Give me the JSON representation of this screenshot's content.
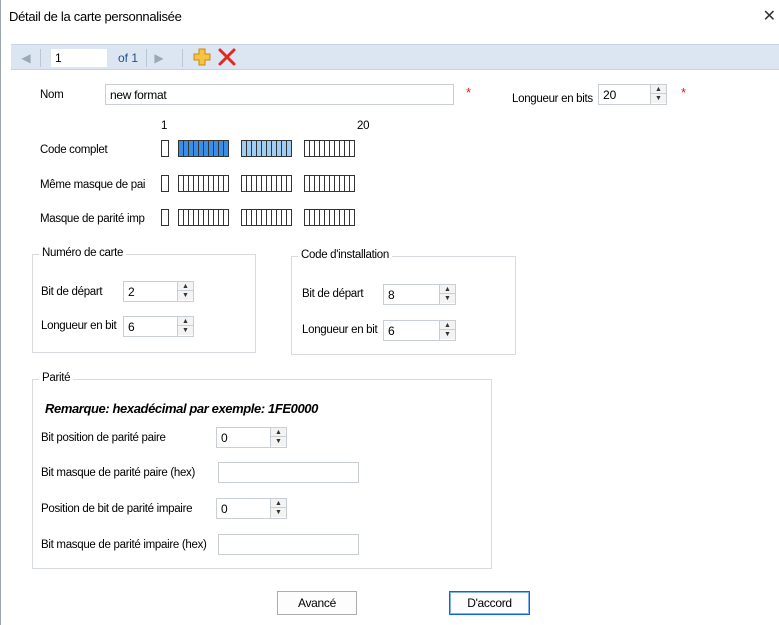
{
  "window": {
    "title": "Détail de la carte personnalisée",
    "close_glyph": "✕"
  },
  "navigator": {
    "current_page": "1",
    "of_label": "of 1",
    "first_icon": "prev-arrow-icon",
    "next_icon": "next-arrow-icon",
    "add_icon": "add-plus-icon",
    "delete_icon": "delete-x-icon"
  },
  "format": {
    "name_label": "Nom",
    "name_value": "new format",
    "length_label": "Longueur en bits",
    "length_value": "20",
    "required_mark": "*"
  },
  "bit_preview": {
    "start_index": "1",
    "end_index": "20",
    "rows": [
      {
        "label": "Code complet"
      },
      {
        "label": "Même masque de pai"
      },
      {
        "label": "Masque de parité imp"
      }
    ],
    "highlight_dark": "#3a8ee6",
    "highlight_light": "#9fcdf3"
  },
  "card_number": {
    "title": "Numéro de carte",
    "start_label": "Bit de départ",
    "start_value": "2",
    "length_label": "Longueur en bit",
    "length_value": "6"
  },
  "facility_code": {
    "title": "Code d'installation",
    "start_label": "Bit de départ",
    "start_value": "8",
    "length_label": "Longueur en bit",
    "length_value": "6"
  },
  "parity": {
    "title": "Parité",
    "note": "Remarque: hexadécimal par exemple: 1FE0000",
    "even_pos_label": "Bit position de parité paire",
    "even_pos_value": "0",
    "even_mask_label": "Bit masque de parité paire (hex)",
    "even_mask_value": "",
    "odd_pos_label": "Position de bit de parité impaire",
    "odd_pos_value": "0",
    "odd_mask_label": "Bit masque de parité impaire (hex)",
    "odd_mask_value": ""
  },
  "actions": {
    "advanced_label": "Avancé",
    "ok_label": "D'accord"
  }
}
